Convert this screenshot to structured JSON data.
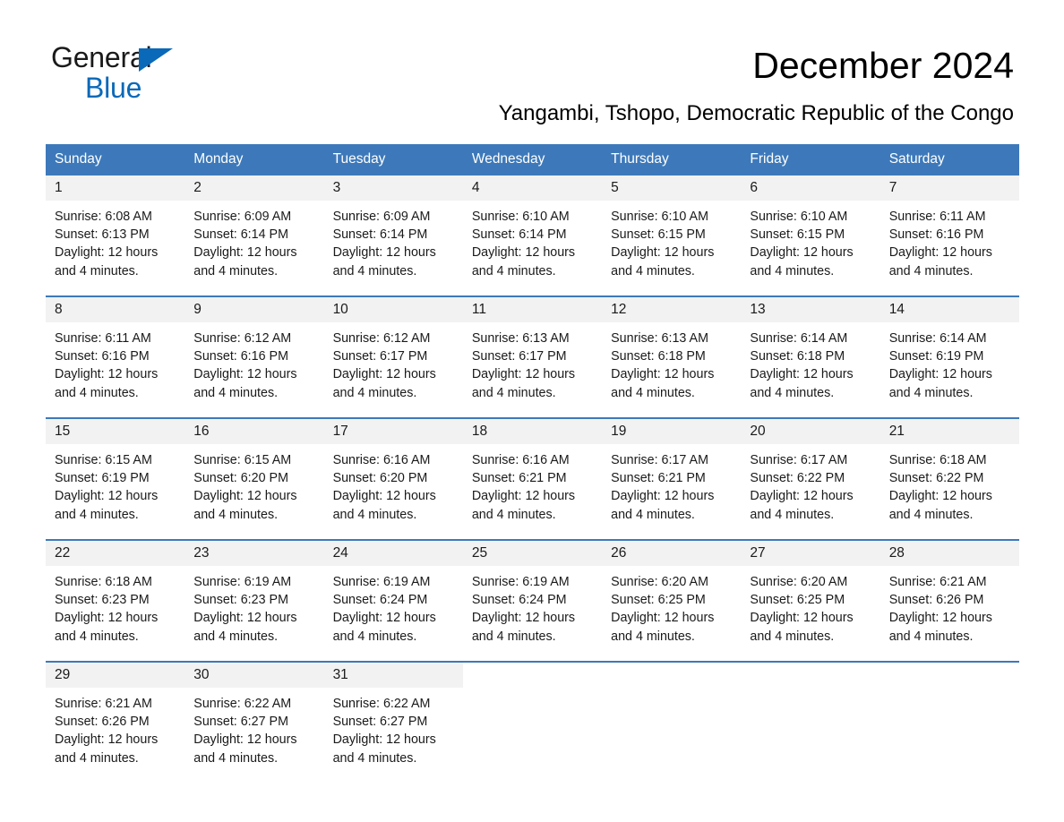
{
  "brand": {
    "name_part1": "General",
    "name_part2": "Blue",
    "accent_color": "#0a69b8"
  },
  "header": {
    "title": "December 2024",
    "subtitle": "Yangambi, Tshopo, Democratic Republic of the Congo"
  },
  "theme": {
    "header_blue": "#3d79ba",
    "daynum_band": "#f2f2f2",
    "text": "#1a1a1a"
  },
  "calendar": {
    "day_headers": [
      "Sunday",
      "Monday",
      "Tuesday",
      "Wednesday",
      "Thursday",
      "Friday",
      "Saturday"
    ],
    "weeks": [
      [
        {
          "day": "1",
          "sunrise": "Sunrise: 6:08 AM",
          "sunset": "Sunset: 6:13 PM",
          "daylight": "Daylight: 12 hours and 4 minutes."
        },
        {
          "day": "2",
          "sunrise": "Sunrise: 6:09 AM",
          "sunset": "Sunset: 6:14 PM",
          "daylight": "Daylight: 12 hours and 4 minutes."
        },
        {
          "day": "3",
          "sunrise": "Sunrise: 6:09 AM",
          "sunset": "Sunset: 6:14 PM",
          "daylight": "Daylight: 12 hours and 4 minutes."
        },
        {
          "day": "4",
          "sunrise": "Sunrise: 6:10 AM",
          "sunset": "Sunset: 6:14 PM",
          "daylight": "Daylight: 12 hours and 4 minutes."
        },
        {
          "day": "5",
          "sunrise": "Sunrise: 6:10 AM",
          "sunset": "Sunset: 6:15 PM",
          "daylight": "Daylight: 12 hours and 4 minutes."
        },
        {
          "day": "6",
          "sunrise": "Sunrise: 6:10 AM",
          "sunset": "Sunset: 6:15 PM",
          "daylight": "Daylight: 12 hours and 4 minutes."
        },
        {
          "day": "7",
          "sunrise": "Sunrise: 6:11 AM",
          "sunset": "Sunset: 6:16 PM",
          "daylight": "Daylight: 12 hours and 4 minutes."
        }
      ],
      [
        {
          "day": "8",
          "sunrise": "Sunrise: 6:11 AM",
          "sunset": "Sunset: 6:16 PM",
          "daylight": "Daylight: 12 hours and 4 minutes."
        },
        {
          "day": "9",
          "sunrise": "Sunrise: 6:12 AM",
          "sunset": "Sunset: 6:16 PM",
          "daylight": "Daylight: 12 hours and 4 minutes."
        },
        {
          "day": "10",
          "sunrise": "Sunrise: 6:12 AM",
          "sunset": "Sunset: 6:17 PM",
          "daylight": "Daylight: 12 hours and 4 minutes."
        },
        {
          "day": "11",
          "sunrise": "Sunrise: 6:13 AM",
          "sunset": "Sunset: 6:17 PM",
          "daylight": "Daylight: 12 hours and 4 minutes."
        },
        {
          "day": "12",
          "sunrise": "Sunrise: 6:13 AM",
          "sunset": "Sunset: 6:18 PM",
          "daylight": "Daylight: 12 hours and 4 minutes."
        },
        {
          "day": "13",
          "sunrise": "Sunrise: 6:14 AM",
          "sunset": "Sunset: 6:18 PM",
          "daylight": "Daylight: 12 hours and 4 minutes."
        },
        {
          "day": "14",
          "sunrise": "Sunrise: 6:14 AM",
          "sunset": "Sunset: 6:19 PM",
          "daylight": "Daylight: 12 hours and 4 minutes."
        }
      ],
      [
        {
          "day": "15",
          "sunrise": "Sunrise: 6:15 AM",
          "sunset": "Sunset: 6:19 PM",
          "daylight": "Daylight: 12 hours and 4 minutes."
        },
        {
          "day": "16",
          "sunrise": "Sunrise: 6:15 AM",
          "sunset": "Sunset: 6:20 PM",
          "daylight": "Daylight: 12 hours and 4 minutes."
        },
        {
          "day": "17",
          "sunrise": "Sunrise: 6:16 AM",
          "sunset": "Sunset: 6:20 PM",
          "daylight": "Daylight: 12 hours and 4 minutes."
        },
        {
          "day": "18",
          "sunrise": "Sunrise: 6:16 AM",
          "sunset": "Sunset: 6:21 PM",
          "daylight": "Daylight: 12 hours and 4 minutes."
        },
        {
          "day": "19",
          "sunrise": "Sunrise: 6:17 AM",
          "sunset": "Sunset: 6:21 PM",
          "daylight": "Daylight: 12 hours and 4 minutes."
        },
        {
          "day": "20",
          "sunrise": "Sunrise: 6:17 AM",
          "sunset": "Sunset: 6:22 PM",
          "daylight": "Daylight: 12 hours and 4 minutes."
        },
        {
          "day": "21",
          "sunrise": "Sunrise: 6:18 AM",
          "sunset": "Sunset: 6:22 PM",
          "daylight": "Daylight: 12 hours and 4 minutes."
        }
      ],
      [
        {
          "day": "22",
          "sunrise": "Sunrise: 6:18 AM",
          "sunset": "Sunset: 6:23 PM",
          "daylight": "Daylight: 12 hours and 4 minutes."
        },
        {
          "day": "23",
          "sunrise": "Sunrise: 6:19 AM",
          "sunset": "Sunset: 6:23 PM",
          "daylight": "Daylight: 12 hours and 4 minutes."
        },
        {
          "day": "24",
          "sunrise": "Sunrise: 6:19 AM",
          "sunset": "Sunset: 6:24 PM",
          "daylight": "Daylight: 12 hours and 4 minutes."
        },
        {
          "day": "25",
          "sunrise": "Sunrise: 6:19 AM",
          "sunset": "Sunset: 6:24 PM",
          "daylight": "Daylight: 12 hours and 4 minutes."
        },
        {
          "day": "26",
          "sunrise": "Sunrise: 6:20 AM",
          "sunset": "Sunset: 6:25 PM",
          "daylight": "Daylight: 12 hours and 4 minutes."
        },
        {
          "day": "27",
          "sunrise": "Sunrise: 6:20 AM",
          "sunset": "Sunset: 6:25 PM",
          "daylight": "Daylight: 12 hours and 4 minutes."
        },
        {
          "day": "28",
          "sunrise": "Sunrise: 6:21 AM",
          "sunset": "Sunset: 6:26 PM",
          "daylight": "Daylight: 12 hours and 4 minutes."
        }
      ],
      [
        {
          "day": "29",
          "sunrise": "Sunrise: 6:21 AM",
          "sunset": "Sunset: 6:26 PM",
          "daylight": "Daylight: 12 hours and 4 minutes."
        },
        {
          "day": "30",
          "sunrise": "Sunrise: 6:22 AM",
          "sunset": "Sunset: 6:27 PM",
          "daylight": "Daylight: 12 hours and 4 minutes."
        },
        {
          "day": "31",
          "sunrise": "Sunrise: 6:22 AM",
          "sunset": "Sunset: 6:27 PM",
          "daylight": "Daylight: 12 hours and 4 minutes."
        },
        {
          "day": "",
          "sunrise": "",
          "sunset": "",
          "daylight": ""
        },
        {
          "day": "",
          "sunrise": "",
          "sunset": "",
          "daylight": ""
        },
        {
          "day": "",
          "sunrise": "",
          "sunset": "",
          "daylight": ""
        },
        {
          "day": "",
          "sunrise": "",
          "sunset": "",
          "daylight": ""
        }
      ]
    ]
  }
}
